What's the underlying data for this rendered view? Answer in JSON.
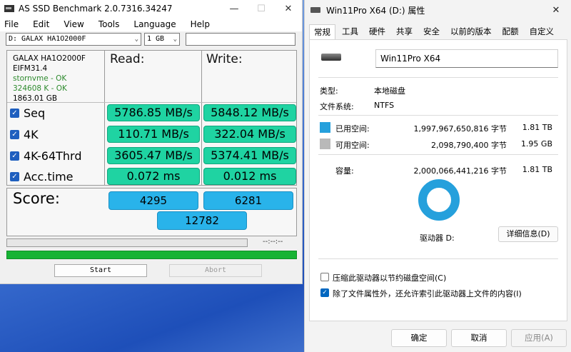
{
  "assd": {
    "title": "AS SSD Benchmark 2.0.7316.34247",
    "menu": [
      "File",
      "Edit",
      "View",
      "Tools",
      "Language",
      "Help"
    ],
    "drive_select": "D: GALAX HA1O2000F",
    "size_select": "1 GB",
    "drive_info": {
      "model": "GALAX HA1O2000F",
      "firmware": "EIFM31.4",
      "driver": "stornvme - OK",
      "alignment": "324608 K - OK",
      "capacity": "1863.01 GB"
    },
    "headers": {
      "read": "Read:",
      "write": "Write:"
    },
    "rows": [
      {
        "label": "Seq",
        "read": "5786.85 MB/s",
        "write": "5848.12 MB/s"
      },
      {
        "label": "4K",
        "read": "110.71 MB/s",
        "write": "322.04 MB/s"
      },
      {
        "label": "4K-64Thrd",
        "read": "3605.47 MB/s",
        "write": "5374.41 MB/s"
      },
      {
        "label": "Acc.time",
        "read": "0.072 ms",
        "write": "0.012 ms"
      }
    ],
    "score": {
      "label": "Score:",
      "read": "4295",
      "write": "6281",
      "total": "12782"
    },
    "time_display": "--:--:--",
    "progress": 1.0,
    "buttons": {
      "start": "Start",
      "abort": "Abort"
    },
    "colors": {
      "result": "#1fd3a2",
      "score": "#29b3ea",
      "progress": "#16b334"
    }
  },
  "props": {
    "title": "Win11Pro X64 (D:) 属性",
    "tabs": [
      "常规",
      "工具",
      "硬件",
      "共享",
      "安全",
      "以前的版本",
      "配额",
      "自定义"
    ],
    "volume_name": "Win11Pro X64",
    "type_label": "类型:",
    "type_value": "本地磁盘",
    "fs_label": "文件系统:",
    "fs_value": "NTFS",
    "used_label": "已用空间:",
    "used_bytes": "1,997,967,650,816 字节",
    "used_size": "1.81 TB",
    "free_label": "可用空间:",
    "free_bytes": "2,098,790,400 字节",
    "free_size": "1.95 GB",
    "cap_label": "容量:",
    "cap_bytes": "2,000,066,441,216 字节",
    "cap_size": "1.81 TB",
    "drive_label": "驱动器 D:",
    "details_button": "详细信息(D)",
    "compress_label": "压缩此驱动器以节约磁盘空间(C)",
    "index_label": "除了文件属性外，还允许索引此驱动器上文件的内容(I)",
    "ok": "确定",
    "cancel": "取消",
    "apply": "应用(A)",
    "colors": {
      "used": "#25a0dc",
      "free": "#b9b9b9"
    }
  }
}
